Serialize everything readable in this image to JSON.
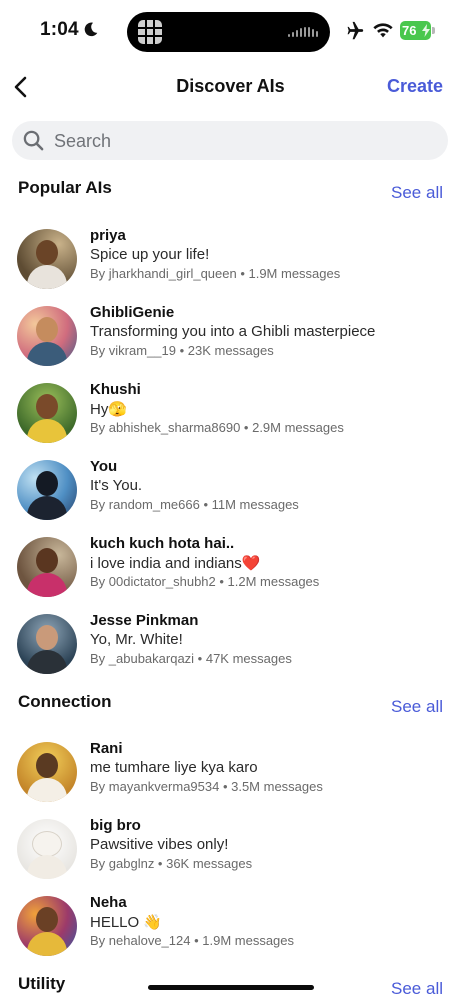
{
  "status_bar": {
    "time": "1:04",
    "battery": "76",
    "colors": {
      "battery": "#49c74d"
    },
    "icons": [
      "moon-icon",
      "airplane-icon",
      "wifi-icon",
      "battery-icon"
    ]
  },
  "header": {
    "title": "Discover AIs",
    "create_label": "Create",
    "accent": "#4a5bd8"
  },
  "search": {
    "placeholder": "Search"
  },
  "sections": {
    "popular": {
      "title": "Popular AIs",
      "see_all": "See all",
      "items": [
        {
          "name": "priya",
          "desc": "Spice up your life!",
          "meta": "By jharkhandi_girl_queen • 1.9M messages"
        },
        {
          "name": "GhibliGenie",
          "desc": "Transforming you into a Ghibli masterpiece",
          "meta": "By vikram__19 • 23K messages"
        },
        {
          "name": "Khushi",
          "desc": "Hy🫣",
          "meta": "By abhishek_sharma8690 • 2.9M messages"
        },
        {
          "name": "You",
          "desc": "It's You.",
          "meta": "By random_me666 • 11M messages"
        },
        {
          "name": "kuch kuch hota hai..",
          "desc": "i love india and indians❤️",
          "meta": "By 00dictator_shubh2 • 1.2M messages"
        },
        {
          "name": "Jesse Pinkman",
          "desc": "Yo, Mr. White!",
          "meta": "By _abubakarqazi • 47K messages"
        }
      ]
    },
    "connection": {
      "title": "Connection",
      "see_all": "See all",
      "items": [
        {
          "name": "Rani",
          "desc": "me tumhare liye kya karo",
          "meta": "By mayankverma9534 • 3.5M messages"
        },
        {
          "name": "big bro",
          "desc": "Pawsitive vibes only!",
          "meta": "By gabglnz • 36K messages"
        },
        {
          "name": "Neha",
          "desc": "HELLO 👋",
          "meta": "By nehalove_124 • 1.9M messages"
        }
      ]
    },
    "utility": {
      "title": "Utility",
      "see_all": "See all"
    }
  }
}
